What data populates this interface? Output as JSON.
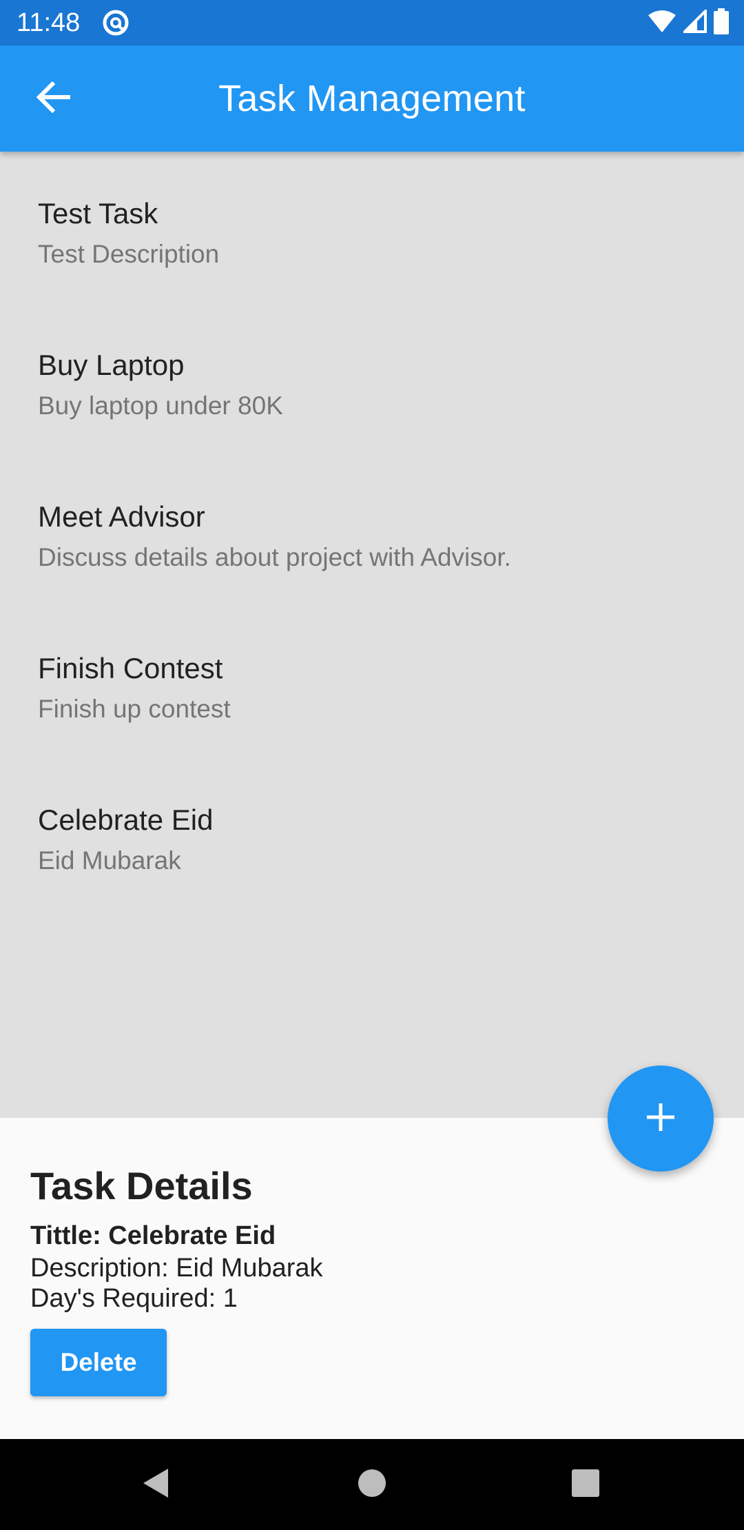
{
  "status_bar": {
    "time": "11:48",
    "app_icon": "at-sign-icon",
    "wifi_icon": "wifi-icon",
    "signal_icon": "signal-icon",
    "battery_icon": "battery-icon"
  },
  "app_bar": {
    "title": "Task Management",
    "back_icon": "arrow-back-icon",
    "color": "#2196f3"
  },
  "tasks": [
    {
      "title": "Test Task",
      "description": "Test Description"
    },
    {
      "title": "Buy Laptop",
      "description": "Buy laptop under 80K"
    },
    {
      "title": "Meet Advisor",
      "description": "Discuss details about project with Advisor."
    },
    {
      "title": "Finish Contest",
      "description": "Finish up contest"
    },
    {
      "title": "Celebrate Eid",
      "description": "Eid Mubarak"
    }
  ],
  "fab": {
    "icon": "plus-icon"
  },
  "task_details": {
    "heading": "Task Details",
    "title_line": "Tittle: Celebrate Eid",
    "description_line": "Description: Eid Mubarak",
    "days_line": "Day's Required: 1",
    "delete_label": "Delete"
  },
  "nav_bar": {
    "back_icon": "nav-back-icon",
    "home_icon": "nav-home-icon",
    "recents_icon": "nav-recents-icon"
  }
}
